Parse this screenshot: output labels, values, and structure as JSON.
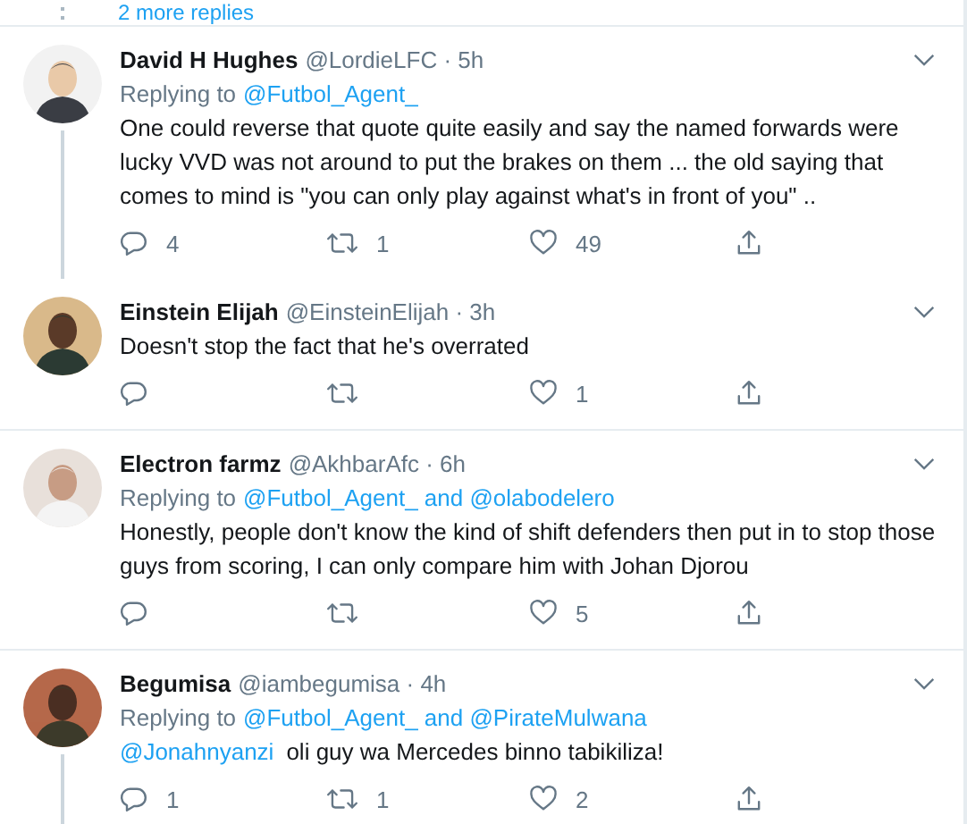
{
  "more_replies": "2 more replies",
  "tweets": [
    {
      "name": "David H Hughes",
      "meta": "@LordieLFC · 5h",
      "replying": {
        "label": "Replying to",
        "targets": "@Futbol_Agent_"
      },
      "text": "One could reverse that quote quite easily and say the named forwards were lucky VVD was not around to put the brakes on them ... the old saying that comes to mind is \"you can only play against what's in front of you\" ..",
      "counts": {
        "replies": "4",
        "retweets": "1",
        "likes": "49"
      },
      "thread_line": true
    },
    {
      "name": "Einstein Elijah",
      "meta": "@EinsteinElijah · 3h",
      "text": "Doesn't stop the fact that he's overrated",
      "counts": {
        "likes": "1"
      },
      "thread_line": false
    },
    {
      "name": "Electron farmz",
      "meta": "@AkhbarAfc · 6h",
      "replying": {
        "label": "Replying to",
        "targets": "@Futbol_Agent_ and @olabodelero"
      },
      "text": "Honestly, people don't know the kind of shift defenders then put in to stop those guys from scoring, I can only compare him with Johan Djorou",
      "counts": {
        "likes": "5"
      },
      "thread_line": false
    },
    {
      "name": "Begumisa",
      "meta": "@iambegumisa · 4h",
      "replying": {
        "label": "Replying to",
        "targets": "@Futbol_Agent_ and @PirateMulwana"
      },
      "mention": "@Jonahnyanzi",
      "text": "oli guy wa Mercedes binno tabikiliza!",
      "counts": {
        "replies": "1",
        "retweets": "1",
        "likes": "2"
      },
      "thread_line": true
    }
  ]
}
